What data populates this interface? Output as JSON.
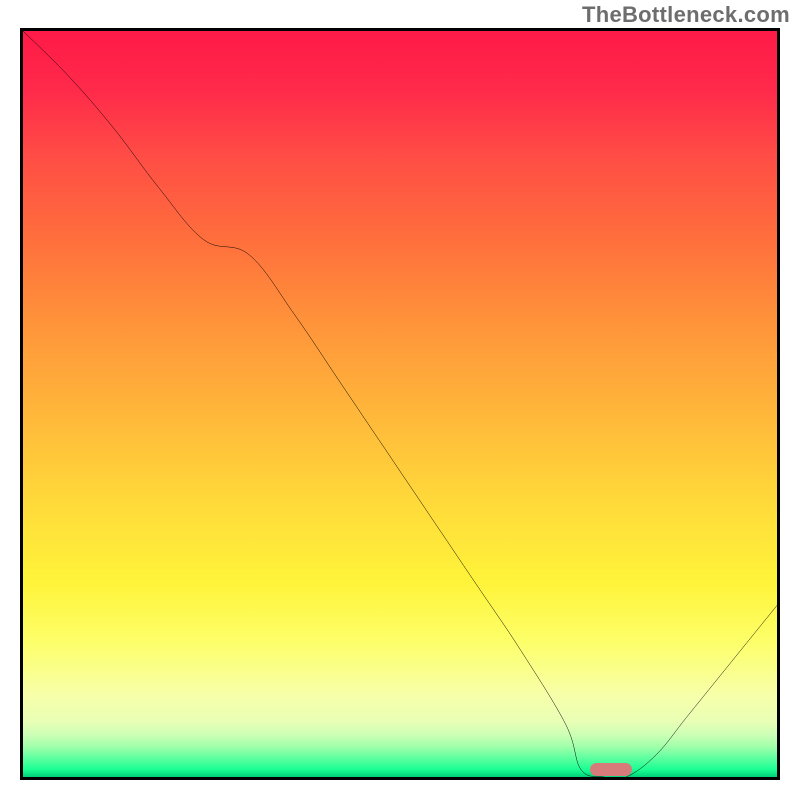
{
  "watermark": "TheBottleneck.com",
  "chart_data": {
    "type": "line",
    "title": "",
    "xlabel": "",
    "ylabel": "",
    "xlim": [
      0,
      100
    ],
    "ylim": [
      0,
      100
    ],
    "grid": false,
    "background": "rainbow-heat-gradient-vertical",
    "series": [
      {
        "name": "bottleneck-curve",
        "x": [
          0,
          6,
          12,
          18,
          24,
          30,
          36,
          42,
          48,
          54,
          60,
          66,
          72,
          74,
          77,
          80,
          84,
          88,
          92,
          96,
          100
        ],
        "y": [
          100,
          94,
          87,
          79,
          72,
          70,
          62,
          53,
          44,
          35,
          26,
          17,
          7,
          1,
          0,
          0,
          3,
          8,
          13,
          18,
          23
        ]
      }
    ],
    "marker": {
      "name": "optimal-point",
      "x": 78,
      "y": 0,
      "width_pct": 5.6,
      "height_pct": 1.8,
      "color": "#d77a7a"
    }
  }
}
